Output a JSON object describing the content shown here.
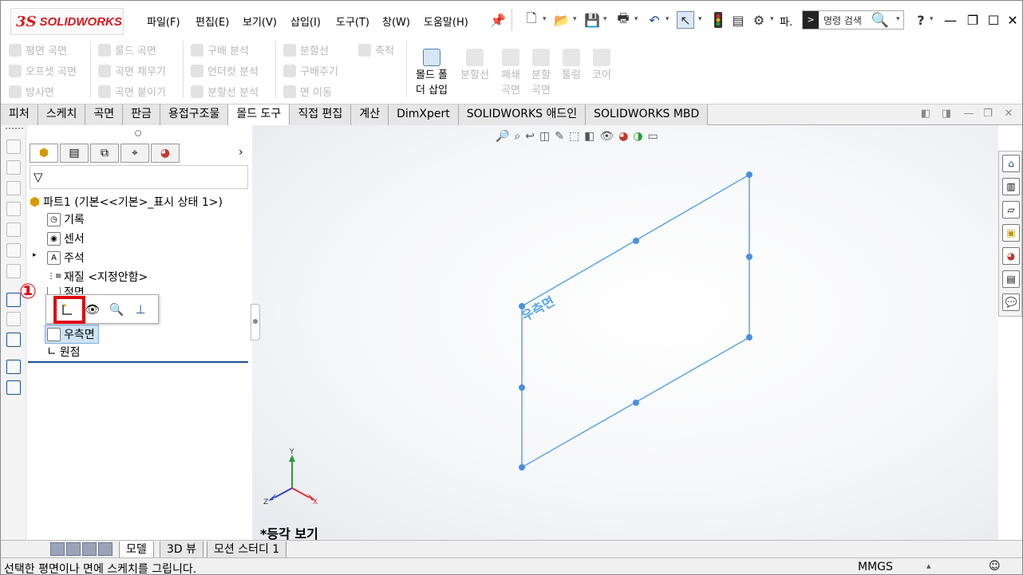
{
  "app": {
    "logo_ds": "3S",
    "logo_text": "SOLIDWORKS"
  },
  "menu": [
    "파일(F)",
    "편집(E)",
    "보기(V)",
    "삽입(I)",
    "도구(T)",
    "창(W)",
    "도움말(H)"
  ],
  "toolbar": {
    "truncated_label": "파.",
    "search_placeholder": "명령 검색",
    "help": "?"
  },
  "ribbon": {
    "col1": [
      "평면 곡면",
      "오프셋 곡면",
      "방사면"
    ],
    "col2": [
      "룰드 곡면",
      "곡면 채우기",
      "곡면 붙이기"
    ],
    "col3": [
      "구배 분석",
      "언더컷 분석",
      "분할선 분석"
    ],
    "col4": [
      "분할선",
      "구배주기",
      "면 이동"
    ],
    "col5": [
      "축척"
    ],
    "big": [
      {
        "line1": "몰드 폴",
        "line2": "더 삽입"
      },
      {
        "line1": "분할선",
        "line2": ""
      },
      {
        "line1": "폐쇄",
        "line2": "곡면"
      },
      {
        "line1": "분할",
        "line2": "곡면"
      },
      {
        "line1": "툴링",
        "line2": ""
      },
      {
        "line1": "코어",
        "line2": ""
      }
    ]
  },
  "tabs": [
    "피처",
    "스케치",
    "곡면",
    "판금",
    "용접구조물",
    "몰드 도구",
    "직접 편집",
    "계산",
    "DimXpert",
    "SOLIDWORKS 애드인",
    "SOLIDWORKS MBD"
  ],
  "active_tab": "몰드 도구",
  "tree": {
    "root": "파트1 (기본<<기본>_표시 상태 1>)",
    "items": [
      "기록",
      "센서",
      "주석",
      "재질 <지정안함>",
      "정면",
      "우측면",
      "원점"
    ],
    "selected": "우측면"
  },
  "annotation": {
    "marker": "①"
  },
  "viewport": {
    "plane_label": "우측면",
    "view_label": "*등각 보기",
    "axis_x": "X",
    "axis_y": "Y",
    "axis_z": "Z"
  },
  "bottom_tabs": [
    "모델",
    "3D 뷰",
    "모션 스터디 1"
  ],
  "status": {
    "message": "선택한 평면이나 면에 스케치를 그립니다.",
    "units": "MMGS"
  },
  "colors": {
    "accent_red": "#e00010",
    "plane_blue": "#5aa6e6",
    "selection_blue": "#cfe3f7"
  }
}
